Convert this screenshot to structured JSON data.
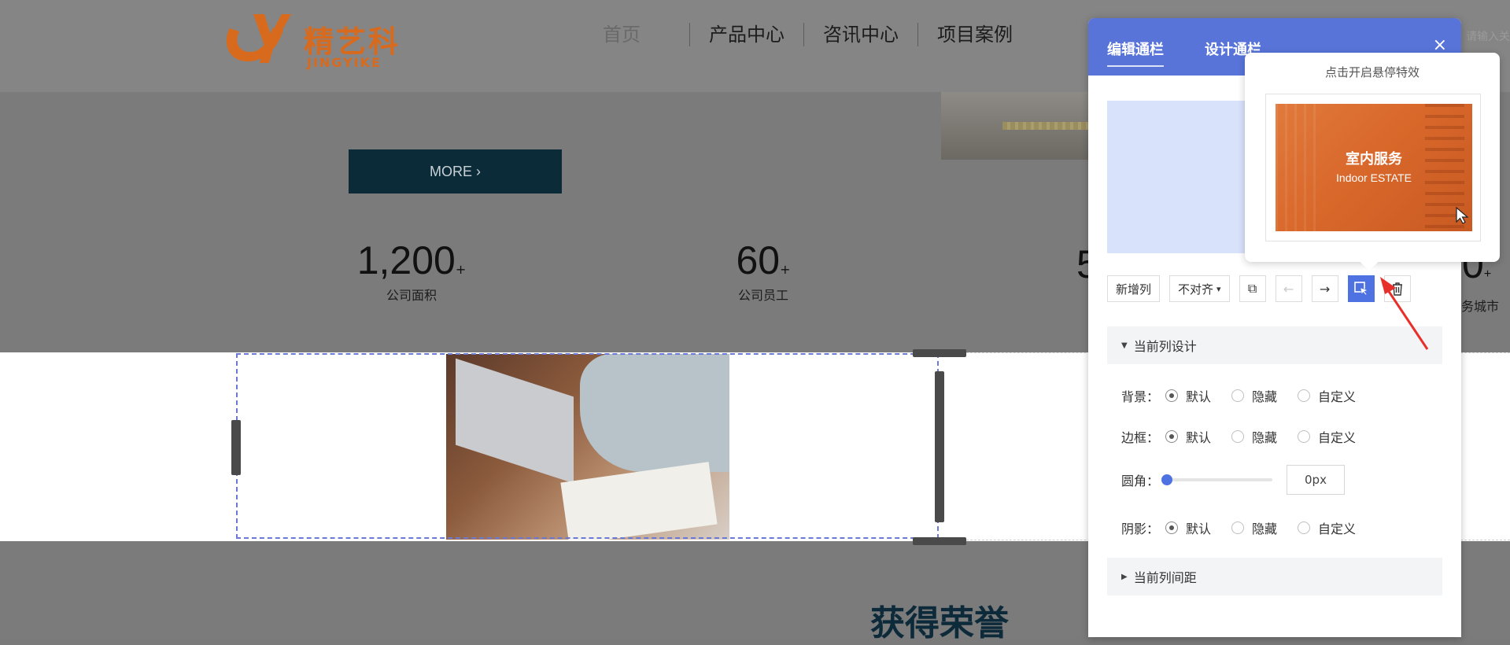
{
  "site": {
    "logo_cn": "精艺科",
    "logo_en": "JINGYIKE",
    "nav": [
      "首页",
      "产品中心",
      "咨讯中心",
      "项目案例"
    ],
    "search_placeholder": "请输入关",
    "more_label": "MORE ›",
    "stats": [
      {
        "num": "1,200",
        "sup": "+",
        "label": "公司面积"
      },
      {
        "num": "60",
        "sup": "+",
        "label": "公司员工"
      }
    ],
    "stat_partial_left": "5",
    "stat_partial_right": "0",
    "stat_partial_right_sup": "+",
    "stat_partial_right_label": "务城市",
    "honor_title": "获得荣誉"
  },
  "panel": {
    "tabs": [
      "编辑通栏",
      "设计通栏"
    ],
    "close": "×",
    "toolbar": {
      "add_column": "新增列",
      "align": "不对齐",
      "align_caret": "▾",
      "copy": "⧉",
      "move_left": "←",
      "move_right": "→",
      "hover_effect": "⬚",
      "delete": "🗑"
    },
    "section_column_design": "当前列设计",
    "section_column_spacing": "当前列间距",
    "background": {
      "label": "背景：",
      "options": [
        "默认",
        "隐藏",
        "自定义"
      ],
      "selected": "默认"
    },
    "border": {
      "label": "边框：",
      "options": [
        "默认",
        "隐藏",
        "自定义"
      ],
      "selected": "默认"
    },
    "radius": {
      "label": "圆角：",
      "value": "0px",
      "level": 0
    },
    "shadow": {
      "label": "阴影：",
      "options": [
        "默认",
        "隐藏",
        "自定义"
      ],
      "selected": "默认"
    }
  },
  "popover": {
    "title": "点击开启悬停特效",
    "image_title_cn": "室内服务",
    "image_title_en": "Indoor ESTATE"
  },
  "colors": {
    "accent": "#5874d8",
    "active_button": "#4f72e3",
    "logo_orange": "#d86a1e",
    "arrow_red": "#e8302a"
  }
}
